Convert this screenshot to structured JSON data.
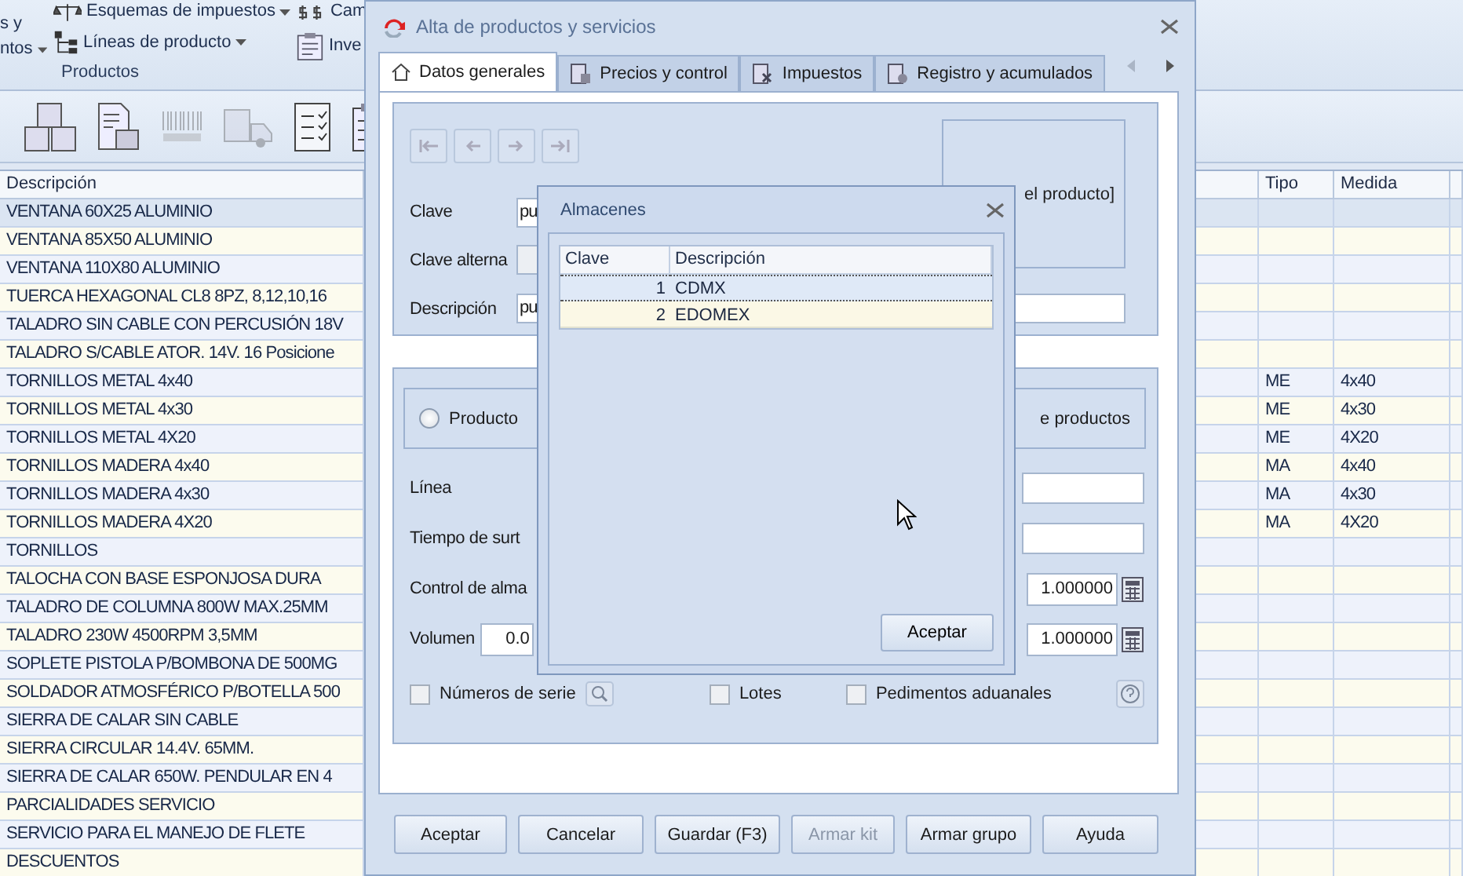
{
  "ribbon": {
    "cut_command": {
      "lines": [
        "s y",
        "ntos"
      ],
      "dropdown": true
    },
    "commands": [
      {
        "label": "Esquemas de impuestos",
        "dropdown": true
      },
      {
        "label": "Líneas de producto",
        "dropdown": true
      }
    ],
    "cut_commands": [
      {
        "label": "Cam"
      },
      {
        "label": "Inve"
      }
    ],
    "group_label": "Productos"
  },
  "toolbar": [
    {
      "disabled": false
    },
    {
      "disabled": false
    },
    {
      "disabled": true
    },
    {
      "disabled": true
    },
    {
      "disabled": false
    },
    {
      "disabled": false
    }
  ],
  "products_grid": {
    "columns": [
      "Descripción",
      "Tipo",
      "Medida"
    ],
    "rows": [
      {
        "description": "VENTANA 60X25 ALUMINIO",
        "selected": true
      },
      {
        "description": "VENTANA 85X50 ALUMINIO",
        "selected": false
      },
      {
        "description": "VENTANA 110X80 ALUMINIO",
        "selected": false
      },
      {
        "description": "TUERCA HEXAGONAL CL8 8PZ, 8,12,10,16",
        "selected": false
      },
      {
        "description": "TALADRO SIN CABLE CON PERCUSIÓN 18V",
        "selected": false
      },
      {
        "description": "TALADRO S/CABLE ATOR. 14V. 16 Posicione",
        "selected": false
      },
      {
        "description": "TORNILLOS METAL 4x40",
        "type": "ME",
        "size": "4x40",
        "selected": false
      },
      {
        "description": "TORNILLOS METAL 4x30",
        "type": "ME",
        "size": "4x30",
        "selected": false
      },
      {
        "description": "TORNILLOS METAL 4X20",
        "type": "ME",
        "size": "4X20",
        "selected": false
      },
      {
        "description": "TORNILLOS MADERA 4x40",
        "type": "MA",
        "size": "4x40",
        "selected": false
      },
      {
        "description": "TORNILLOS MADERA 4x30",
        "type": "MA",
        "size": "4x30",
        "selected": false
      },
      {
        "description": "TORNILLOS MADERA 4X20",
        "type": "MA",
        "size": "4X20",
        "selected": false
      },
      {
        "description": "TORNILLOS",
        "selected": false
      },
      {
        "description": "TALOCHA CON BASE ESPONJOSA DURA",
        "selected": false
      },
      {
        "description": "TALADRO DE COLUMNA 800W  MAX.25MM",
        "selected": false
      },
      {
        "description": "TALADRO 230W 4500RPM 3,5MM",
        "selected": false
      },
      {
        "description": "SOPLETE PISTOLA P/BOMBONA DE 500MG",
        "selected": false
      },
      {
        "description": "SOLDADOR ATMOSFÉRICO P/BOTELLA 500",
        "selected": false
      },
      {
        "description": "SIERRA DE CALAR SIN CABLE",
        "selected": false
      },
      {
        "description": "SIERRA CIRCULAR 14.4V. 65MM.",
        "selected": false
      },
      {
        "description": "SIERRA DE CALAR 650W. PENDULAR EN 4",
        "selected": false
      },
      {
        "description": "PARCIALIDADES SERVICIO",
        "selected": false
      },
      {
        "description": "SERVICIO PARA EL MANEJO DE FLETE",
        "selected": false
      },
      {
        "description": "DESCUENTOS",
        "selected": false
      }
    ]
  },
  "product_dialog": {
    "title": "Alta de productos y servicios",
    "tabs": [
      {
        "label": "Datos generales",
        "selected": true
      },
      {
        "label": "Precios y control",
        "selected": false
      },
      {
        "label": "Impuestos",
        "selected": false
      },
      {
        "label": "Registro y acumulados",
        "selected": false
      }
    ],
    "image_caption": "el producto]",
    "fields": [
      {
        "label": "Clave",
        "value": "pu",
        "kind": "text"
      },
      {
        "label": "Clave alterna",
        "kind": "grey"
      },
      {
        "label": "Descripción",
        "value": "pu",
        "kind": "wide"
      }
    ],
    "type_option": {
      "label": "Producto",
      "selected": false
    },
    "type_option_tail": "e productos",
    "rows": [
      {
        "label": "Línea",
        "kind": "field"
      },
      {
        "label": "Tiempo de surt",
        "kind": "field"
      },
      {
        "label": "Control de alma",
        "kind": "number",
        "value": "1.000000"
      },
      {
        "label": "Volumen",
        "kind": "volume",
        "left_value": "0.0",
        "value": "1.000000"
      }
    ],
    "checkboxes": [
      {
        "label": "Números de serie",
        "checked": false,
        "search": true
      },
      {
        "label": "Lotes",
        "checked": false,
        "search": false
      },
      {
        "label": "Pedimentos aduanales",
        "checked": false,
        "search": false
      }
    ],
    "buttons": [
      {
        "label": "Aceptar",
        "disabled": false
      },
      {
        "label": "Cancelar",
        "disabled": false
      },
      {
        "label": "Guardar (F3)",
        "disabled": false
      },
      {
        "label": "Armar kit",
        "disabled": true
      },
      {
        "label": "Armar grupo",
        "disabled": false
      },
      {
        "label": "Ayuda",
        "disabled": false
      }
    ]
  },
  "warehouse_dialog": {
    "title": "Almacenes",
    "columns": [
      "Clave",
      "Descripción"
    ],
    "rows": [
      {
        "key": "1",
        "description": "CDMX",
        "selected": true
      },
      {
        "key": "2",
        "description": "EDOMEX",
        "selected": false
      }
    ],
    "button": "Aceptar"
  }
}
